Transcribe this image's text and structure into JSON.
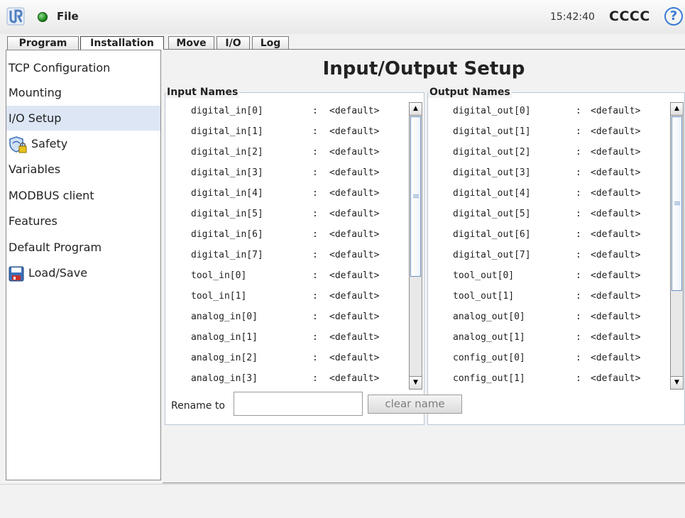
{
  "header": {
    "file_menu": "File",
    "clock": "15:42:40",
    "robot_name": "CCCC",
    "help_symbol": "?",
    "status_color": "#2a9a2a",
    "logo_icon": "ur-logo-icon"
  },
  "tabs": [
    {
      "label": "Program"
    },
    {
      "label": "Installation",
      "selected": true
    },
    {
      "label": "Move"
    },
    {
      "label": "I/O"
    },
    {
      "label": "Log"
    }
  ],
  "sidebar": {
    "items": [
      {
        "label": "TCP Configuration"
      },
      {
        "label": "Mounting"
      },
      {
        "label": "I/O Setup",
        "selected": true
      },
      {
        "label": "Safety",
        "icon": "safety-shield-lock-icon"
      },
      {
        "label": "Variables"
      },
      {
        "label": "MODBUS client"
      },
      {
        "label": "Features"
      },
      {
        "label": "Default Program"
      },
      {
        "label": "Load/Save",
        "icon": "floppy-disk-icon"
      }
    ]
  },
  "main": {
    "title": "Input/Output Setup",
    "input_group": {
      "title": "Input Names",
      "separator": ":",
      "rows": [
        {
          "name": "digital_in[0]",
          "value": "<default>"
        },
        {
          "name": "digital_in[1]",
          "value": "<default>"
        },
        {
          "name": "digital_in[2]",
          "value": "<default>"
        },
        {
          "name": "digital_in[3]",
          "value": "<default>"
        },
        {
          "name": "digital_in[4]",
          "value": "<default>"
        },
        {
          "name": "digital_in[5]",
          "value": "<default>"
        },
        {
          "name": "digital_in[6]",
          "value": "<default>"
        },
        {
          "name": "digital_in[7]",
          "value": "<default>"
        },
        {
          "name": "tool_in[0]",
          "value": "<default>"
        },
        {
          "name": "tool_in[1]",
          "value": "<default>"
        },
        {
          "name": "analog_in[0]",
          "value": "<default>"
        },
        {
          "name": "analog_in[1]",
          "value": "<default>"
        },
        {
          "name": "analog_in[2]",
          "value": "<default>"
        },
        {
          "name": "analog_in[3]",
          "value": "<default>"
        }
      ]
    },
    "output_group": {
      "title": "Output Names",
      "separator": ":",
      "rows": [
        {
          "name": "digital_out[0]",
          "value": "<default>"
        },
        {
          "name": "digital_out[1]",
          "value": "<default>"
        },
        {
          "name": "digital_out[2]",
          "value": "<default>"
        },
        {
          "name": "digital_out[3]",
          "value": "<default>"
        },
        {
          "name": "digital_out[4]",
          "value": "<default>"
        },
        {
          "name": "digital_out[5]",
          "value": "<default>"
        },
        {
          "name": "digital_out[6]",
          "value": "<default>"
        },
        {
          "name": "digital_out[7]",
          "value": "<default>"
        },
        {
          "name": "tool_out[0]",
          "value": "<default>"
        },
        {
          "name": "tool_out[1]",
          "value": "<default>"
        },
        {
          "name": "analog_out[0]",
          "value": "<default>"
        },
        {
          "name": "analog_out[1]",
          "value": "<default>"
        },
        {
          "name": "config_out[0]",
          "value": "<default>"
        },
        {
          "name": "config_out[1]",
          "value": "<default>"
        }
      ]
    },
    "rename": {
      "label": "Rename to",
      "value": "",
      "clear_button": "clear name"
    }
  },
  "colors": {
    "selected_bg": "#dce6f5",
    "accent": "#3a7bd5"
  }
}
